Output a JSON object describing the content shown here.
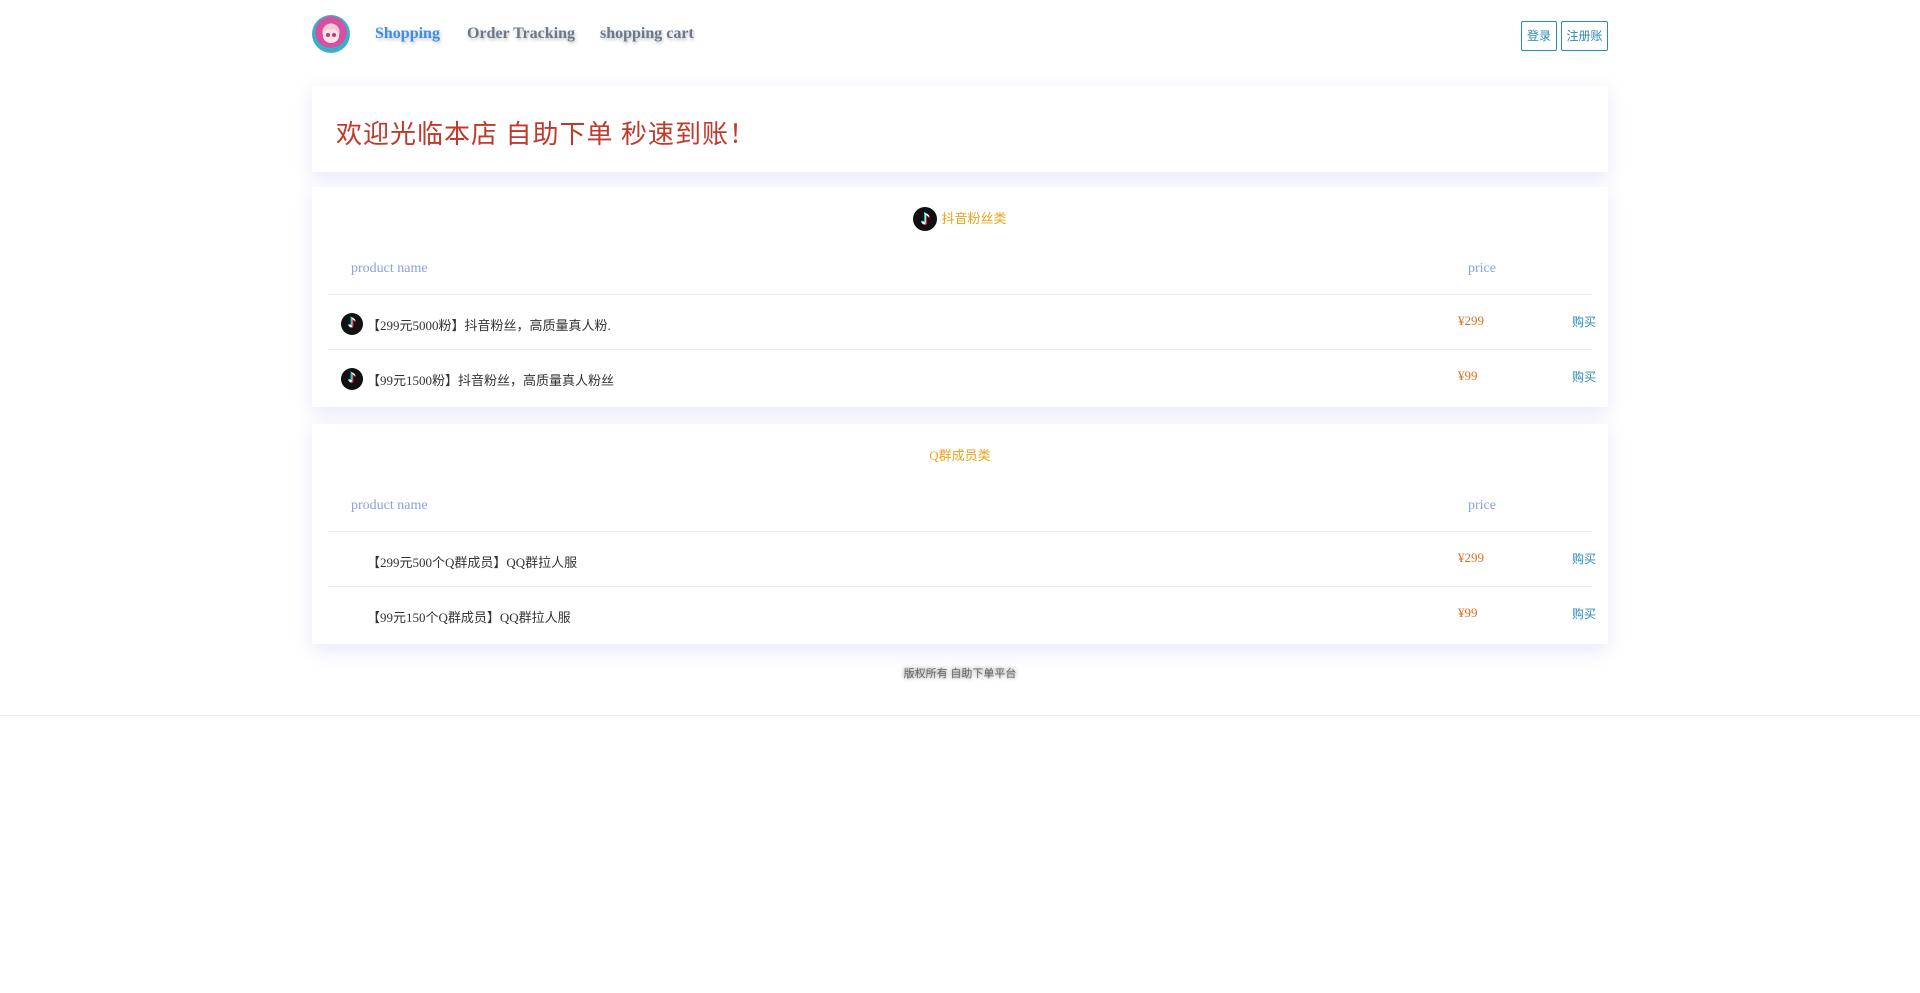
{
  "nav": {
    "shopping": "Shopping",
    "order_tracking": "Order Tracking",
    "shopping_cart": "shopping cart"
  },
  "header_buttons": {
    "login": "登录",
    "register": "注册账"
  },
  "notice": {
    "text": "欢迎光临本店 自助下单 秒速到账！"
  },
  "sections": [
    {
      "title": "抖音粉丝类",
      "icon": "tiktok-icon",
      "columns": {
        "name": "product name",
        "price": "price"
      },
      "items": [
        {
          "name": "【299元5000粉】抖音粉丝，高质量真人粉.",
          "price": "¥299",
          "buy": "购买"
        },
        {
          "name": "【99元1500粉】抖音粉丝，高质量真人粉丝",
          "price": "¥99",
          "buy": "购买"
        }
      ]
    },
    {
      "title": "Q群成员类",
      "icon": "",
      "columns": {
        "name": "product name",
        "price": "price"
      },
      "items": [
        {
          "name": "【299元500个Q群成员】QQ群拉人服",
          "price": "¥299",
          "buy": "购买"
        },
        {
          "name": "【99元150个Q群成员】QQ群拉人服",
          "price": "¥99",
          "buy": "购买"
        }
      ]
    }
  ],
  "footer": {
    "text": "版权所有 自助下单平台"
  },
  "colors": {
    "accent_blue": "#3e8ee6",
    "price_orange": "#e07020",
    "section_title_gold": "#e8a317",
    "notice_red": "#c0392b"
  }
}
